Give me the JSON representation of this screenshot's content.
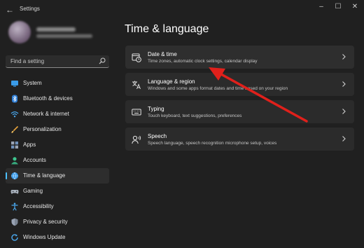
{
  "window": {
    "title": "Settings",
    "back_glyph": "←",
    "minimize_glyph": "–",
    "maximize_glyph": "☐",
    "close_glyph": "✕"
  },
  "search": {
    "placeholder": "Find a setting"
  },
  "sidebar": {
    "items": [
      {
        "label": "System",
        "icon": "system-icon",
        "active": false
      },
      {
        "label": "Bluetooth & devices",
        "icon": "bluetooth-icon",
        "active": false
      },
      {
        "label": "Network & internet",
        "icon": "wifi-icon",
        "active": false
      },
      {
        "label": "Personalization",
        "icon": "brush-icon",
        "active": false
      },
      {
        "label": "Apps",
        "icon": "apps-icon",
        "active": false
      },
      {
        "label": "Accounts",
        "icon": "person-icon",
        "active": false
      },
      {
        "label": "Time & language",
        "icon": "globe-clock-icon",
        "active": true
      },
      {
        "label": "Gaming",
        "icon": "gamepad-icon",
        "active": false
      },
      {
        "label": "Accessibility",
        "icon": "accessibility-icon",
        "active": false
      },
      {
        "label": "Privacy & security",
        "icon": "shield-icon",
        "active": false
      },
      {
        "label": "Windows Update",
        "icon": "update-icon",
        "active": false
      }
    ]
  },
  "main": {
    "title": "Time & language",
    "cards": [
      {
        "title": "Date & time",
        "subtitle": "Time zones, automatic clock settings, calendar display",
        "icon": "clock-calendar-icon"
      },
      {
        "title": "Language & region",
        "subtitle": "Windows and some apps format dates and time based on your region",
        "icon": "language-icon"
      },
      {
        "title": "Typing",
        "subtitle": "Touch keyboard, text suggestions, preferences",
        "icon": "keyboard-icon"
      },
      {
        "title": "Speech",
        "subtitle": "Speech language, speech recognition microphone setup, voices",
        "icon": "speech-icon"
      }
    ]
  },
  "colors": {
    "background": "#202020",
    "card": "#2b2b2b",
    "accent": "#4cc2ff",
    "annotation_arrow": "#e0201b"
  }
}
